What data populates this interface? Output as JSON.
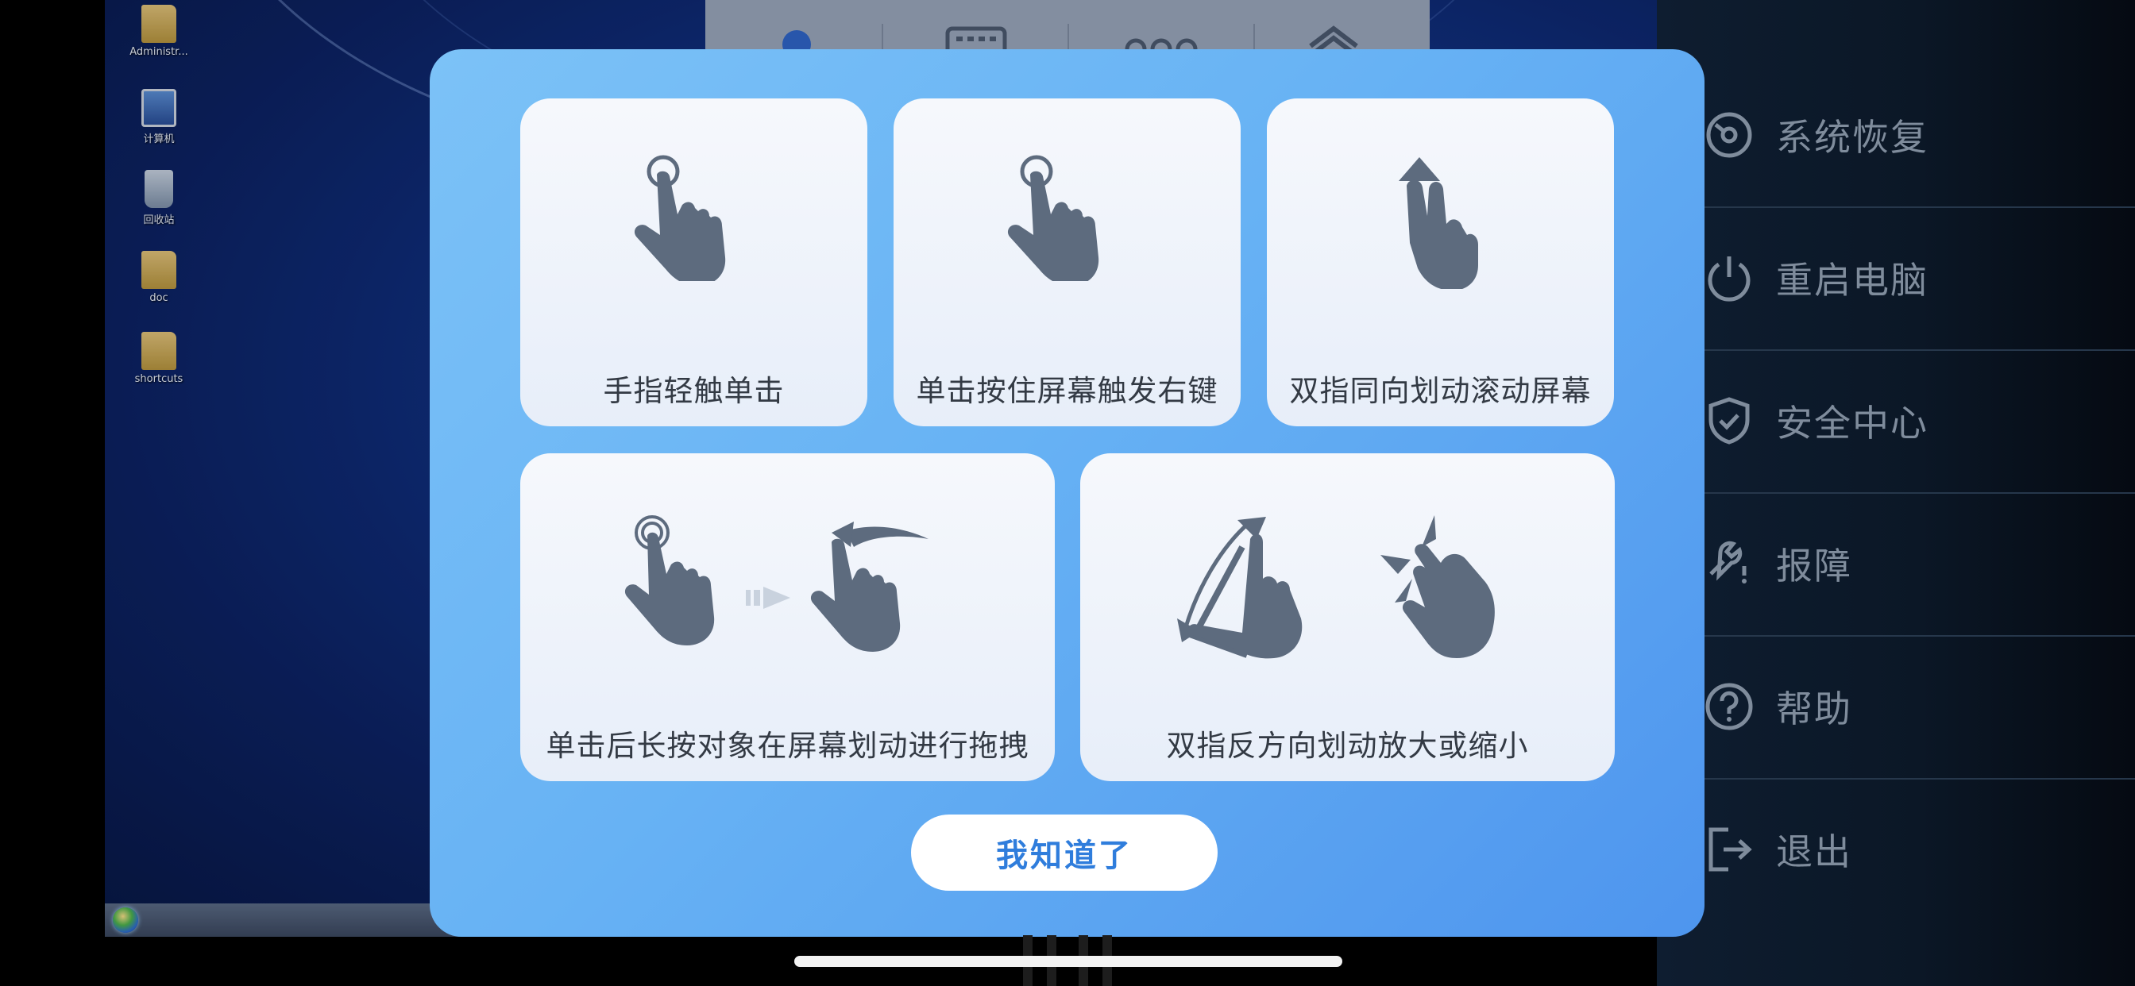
{
  "desktop": {
    "icons": [
      {
        "name": "folder-icon",
        "label": "Administr..."
      },
      {
        "name": "computer-icon",
        "label": "计算机"
      },
      {
        "name": "recycle-bin-icon",
        "label": "回收站"
      },
      {
        "name": "folder-icon",
        "label": "doc"
      },
      {
        "name": "folder-icon",
        "label": "shortcuts"
      }
    ]
  },
  "side_menu": {
    "items": [
      {
        "label": "系统恢复",
        "icon": "system-restore-icon"
      },
      {
        "label": "重启电脑",
        "icon": "power-icon"
      },
      {
        "label": "安全中心",
        "icon": "shield-icon"
      },
      {
        "label": "报障",
        "icon": "wrench-alert-icon"
      },
      {
        "label": "帮助",
        "icon": "help-icon"
      },
      {
        "label": "退出",
        "icon": "exit-icon"
      }
    ]
  },
  "gesture_guide": {
    "cards": [
      {
        "caption": "手指轻触单击",
        "icon": "tap-gesture-icon"
      },
      {
        "caption": "单击按住屏幕触发右键",
        "icon": "press-hold-gesture-icon"
      },
      {
        "caption": "双指同向划动滚动屏幕",
        "icon": "two-finger-scroll-gesture-icon"
      },
      {
        "caption": "单击后长按对象在屏幕划动进行拖拽",
        "icon": "drag-gesture-icon"
      },
      {
        "caption": "双指反方向划动放大或缩小",
        "icon": "pinch-zoom-gesture-icon"
      }
    ],
    "ok_label": "我知道了"
  },
  "colors": {
    "modal_gradient_start": "#7cc2f7",
    "modal_gradient_end": "#4e95ee",
    "hand_fill": "#5d6b7e",
    "button_text": "#2f7ddc",
    "menu_text": "#7f8c9c"
  }
}
